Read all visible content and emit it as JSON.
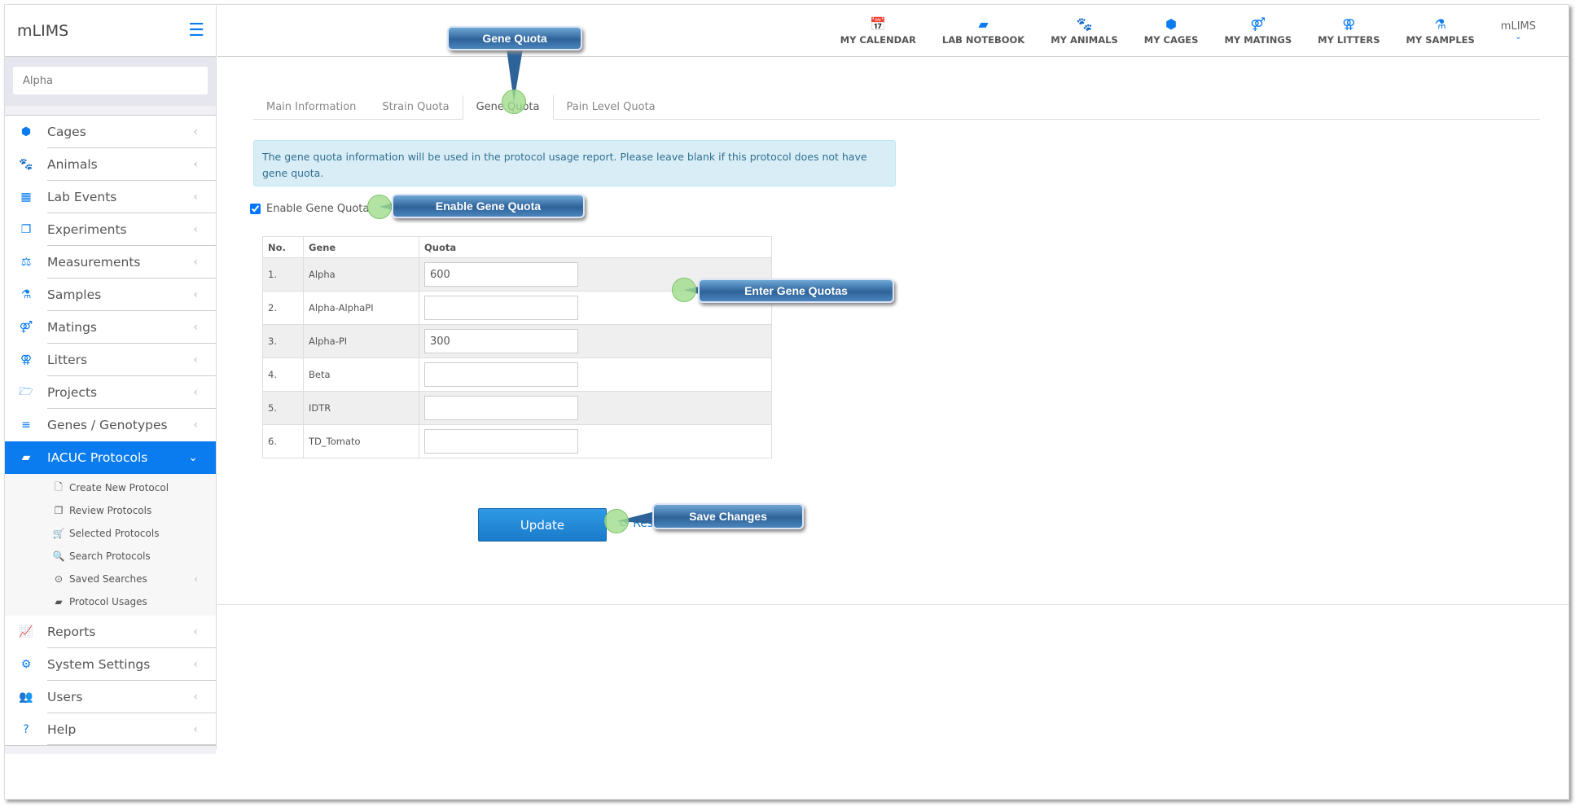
{
  "sidebar": {
    "brand": "mLIMS",
    "search_value": "Alpha",
    "items": [
      {
        "label": "Cages",
        "icon": "cube-icon"
      },
      {
        "label": "Animals",
        "icon": "paw-icon"
      },
      {
        "label": "Lab Events",
        "icon": "calendar-icon"
      },
      {
        "label": "Experiments",
        "icon": "copy-icon"
      },
      {
        "label": "Measurements",
        "icon": "scale-icon"
      },
      {
        "label": "Samples",
        "icon": "flask-icon"
      },
      {
        "label": "Matings",
        "icon": "mating-icon"
      },
      {
        "label": "Litters",
        "icon": "litter-icon"
      },
      {
        "label": "Projects",
        "icon": "folder-icon"
      },
      {
        "label": "Genes / Genotypes",
        "icon": "bars-icon"
      },
      {
        "label": "IACUC Protocols",
        "icon": "book-icon"
      }
    ],
    "sub_items": [
      {
        "label": "Create New Protocol"
      },
      {
        "label": "Review Protocols"
      },
      {
        "label": "Selected Protocols"
      },
      {
        "label": "Search Protocols"
      },
      {
        "label": "Saved Searches"
      },
      {
        "label": "Protocol Usages"
      }
    ],
    "bottom_items": [
      {
        "label": "Reports"
      },
      {
        "label": "System Settings"
      },
      {
        "label": "Users"
      },
      {
        "label": "Help"
      }
    ]
  },
  "header": {
    "nav": [
      {
        "label": "MY CALENDAR"
      },
      {
        "label": "LAB NOTEBOOK"
      },
      {
        "label": "MY ANIMALS"
      },
      {
        "label": "MY CAGES"
      },
      {
        "label": "MY MATINGS"
      },
      {
        "label": "MY LITTERS"
      },
      {
        "label": "MY SAMPLES"
      }
    ],
    "user": "mLIMS"
  },
  "tabs": [
    "Main Information",
    "Strain Quota",
    "Gene Quota",
    "Pain Level Quota"
  ],
  "active_tab": "Gene Quota",
  "info": "The gene quota information will be used in the protocol usage report. Please leave blank if this protocol does not have gene quota.",
  "enable_label": "Enable Gene Quota",
  "enable_checked": true,
  "table": {
    "headers": [
      "No.",
      "Gene",
      "Quota"
    ],
    "rows": [
      {
        "no": "1.",
        "gene": "Alpha",
        "quota": "600"
      },
      {
        "no": "2.",
        "gene": "Alpha-AlphaPI",
        "quota": ""
      },
      {
        "no": "3.",
        "gene": "Alpha-PI",
        "quota": "300"
      },
      {
        "no": "4.",
        "gene": "Beta",
        "quota": ""
      },
      {
        "no": "5.",
        "gene": "IDTR",
        "quota": ""
      },
      {
        "no": "6.",
        "gene": "TD_Tomato",
        "quota": ""
      }
    ]
  },
  "update_label": "Update",
  "reset_label": "Reset",
  "callouts": {
    "gene_quota": "Gene Quota",
    "enable": "Enable Gene Quota",
    "enter": "Enter Gene Quotas",
    "save": "Save Changes"
  },
  "colors": {
    "accent": "#0a7cf0",
    "callout": "#2e6399"
  }
}
